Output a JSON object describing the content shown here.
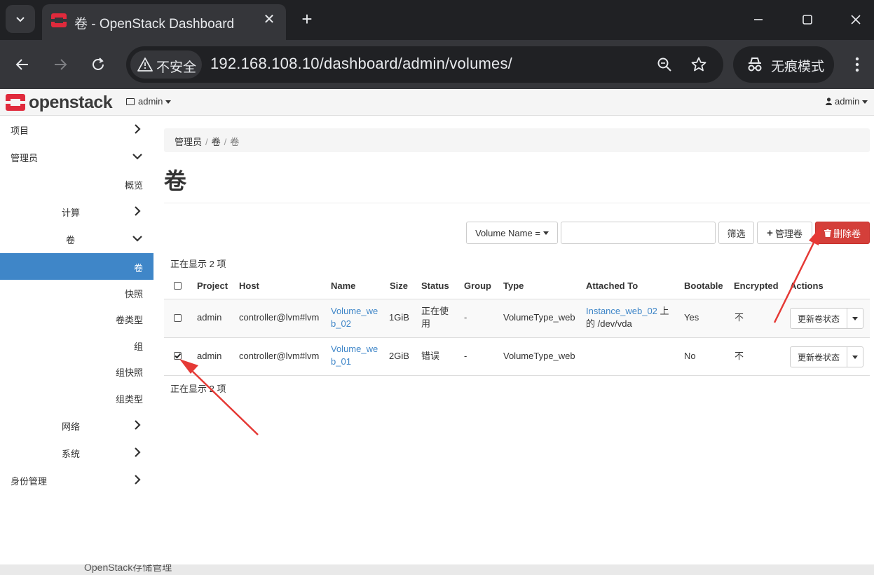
{
  "browser": {
    "tab_title": "卷 - OpenStack Dashboard",
    "insecure_label": "不安全",
    "url": "192.168.108.10/dashboard/admin/volumes/",
    "incognito_label": "无痕模式"
  },
  "navbar": {
    "logo_text": "openstack",
    "project": "admin",
    "user": "admin"
  },
  "sidebar": {
    "items": [
      {
        "label": "项目"
      },
      {
        "label": "管理员"
      },
      {
        "label": "概览"
      },
      {
        "label": "计算"
      },
      {
        "label": "卷"
      },
      {
        "label": "卷"
      },
      {
        "label": "快照"
      },
      {
        "label": "卷类型"
      },
      {
        "label": "组"
      },
      {
        "label": "组快照"
      },
      {
        "label": "组类型"
      },
      {
        "label": "网络"
      },
      {
        "label": "系统"
      },
      {
        "label": "身份管理"
      }
    ]
  },
  "breadcrumb": [
    "管理员",
    "卷",
    "卷"
  ],
  "page_title": "卷",
  "filter": {
    "field_label": "Volume Name =",
    "filter_button": "筛选",
    "manage_button": "管理卷",
    "delete_button": "删除卷"
  },
  "showing_text": "正在显示 2 项",
  "table": {
    "headers": [
      "Project",
      "Host",
      "Name",
      "Size",
      "Status",
      "Group",
      "Type",
      "Attached To",
      "Bootable",
      "Encrypted",
      "Actions"
    ],
    "rows": [
      {
        "checked": false,
        "project": "admin",
        "host": "controller@lvm#lvm",
        "name_l1": "Volume_we",
        "name_l2": "b_02",
        "size": "1GiB",
        "status_l1": "正在使",
        "status_l2": "用",
        "group": "-",
        "type": "VolumeType_web",
        "attached_link": "Instance_web_02",
        "attached_suffix": " 上",
        "attached_l2": "的 /dev/vda",
        "bootable": "Yes",
        "encrypted": "不",
        "action": "更新卷状态"
      },
      {
        "checked": true,
        "project": "admin",
        "host": "controller@lvm#lvm",
        "name_l1": "Volume_we",
        "name_l2": "b_01",
        "size": "2GiB",
        "status_l1": "错误",
        "status_l2": "",
        "group": "-",
        "type": "VolumeType_web",
        "attached_link": "",
        "attached_suffix": "",
        "attached_l2": "",
        "bootable": "No",
        "encrypted": "不",
        "action": "更新卷状态"
      }
    ]
  },
  "bottom_text": "OpenStack存储管理",
  "colors": {
    "accent": "#3f86c8",
    "danger": "#d43f3a",
    "arrow": "#e53935",
    "chrome_dark": "#202124",
    "chrome": "#35363a"
  }
}
